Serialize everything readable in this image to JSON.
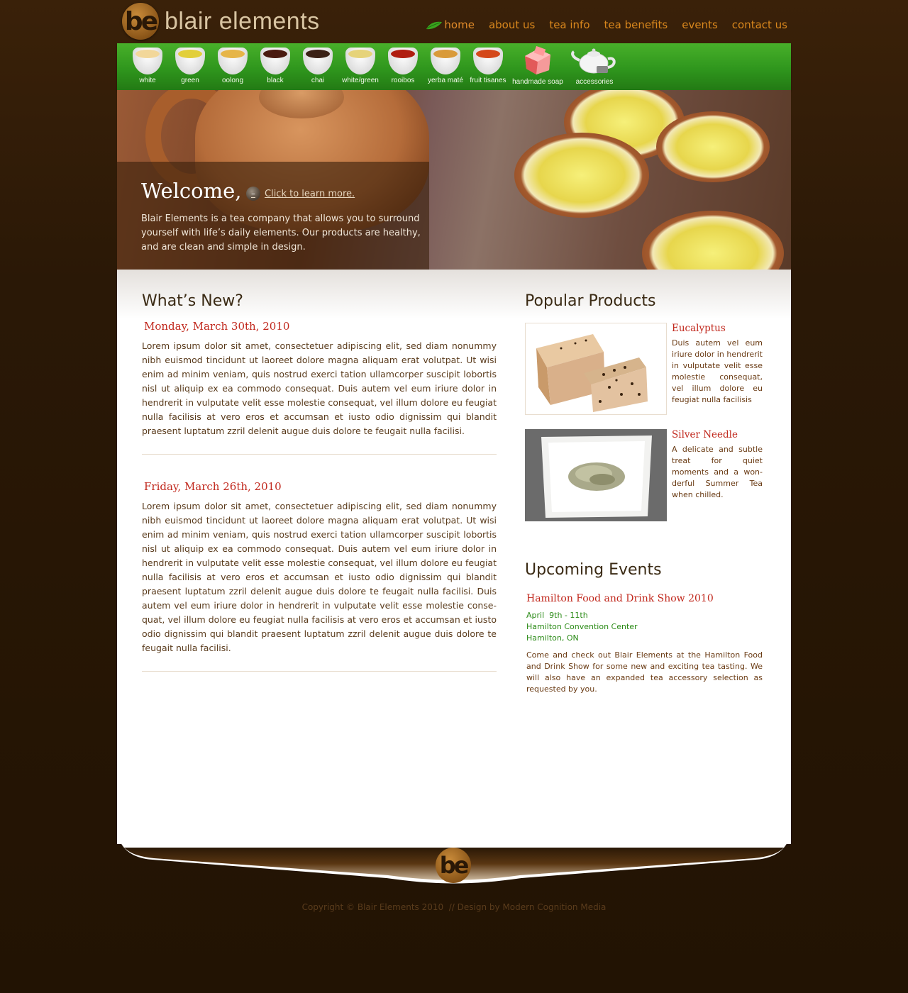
{
  "brand": {
    "logo_mark": "be",
    "name": "blair elements"
  },
  "nav": {
    "items": [
      {
        "label": "home",
        "active": true
      },
      {
        "label": "about us"
      },
      {
        "label": "tea info"
      },
      {
        "label": "tea benefits"
      },
      {
        "label": "events"
      },
      {
        "label": "contact us"
      }
    ]
  },
  "categories": [
    {
      "label": "white",
      "liquid": "#f2d79a",
      "icon": "tea-cup-icon"
    },
    {
      "label": "green",
      "liquid": "#e2cf3a",
      "icon": "tea-cup-icon"
    },
    {
      "label": "oolong",
      "liquid": "#e6b548",
      "icon": "tea-cup-icon"
    },
    {
      "label": "black",
      "liquid": "#4a1a10",
      "icon": "tea-cup-icon"
    },
    {
      "label": "chai",
      "liquid": "#3b2116",
      "icon": "tea-cup-icon"
    },
    {
      "label": "white/green",
      "liquid": "#e6d37a",
      "icon": "tea-cup-icon"
    },
    {
      "label": "rooibos",
      "liquid": "#b01d10",
      "icon": "tea-cup-icon"
    },
    {
      "label": "yerba maté",
      "liquid": "#d99a3a",
      "icon": "tea-cup-icon"
    },
    {
      "label": "fruit tisanes",
      "liquid": "#d4481a",
      "icon": "tea-cup-icon"
    },
    {
      "label": "handmade soap",
      "icon": "soap-icon"
    },
    {
      "label": "accessories",
      "icon": "teapot-icon"
    }
  ],
  "hero": {
    "title": "Welcome,",
    "cta": "Click to learn more.",
    "description": "Blair Elements is a tea company that allows you to surround yourself with life’s daily elements. Our products are healthy, and are clean and simple in design."
  },
  "whats_new": {
    "heading": "What’s New?",
    "posts": [
      {
        "date": "Monday, March 30th, 2010",
        "body": "Lorem ipsum dolor sit amet, consectetuer adipiscing elit, sed diam nonummy nibh euismod tincidunt ut laoreet dolore magna aliquam erat volutpat. Ut wisi enim ad minim veniam, quis nostrud exerci tation ullamcorper suscipit lobortis nisl ut aliquip ex ea commodo consequat. Duis autem vel eum iriure dolor in hendrerit in vulputate velit esse molestie consequat, vel illum dolore eu feugiat nulla facilisis at vero eros et accumsan et iusto odio dignissim qui blandit praesent luptatum zzril delenit augue duis dolore te feugait nulla facilisi."
      },
      {
        "date": "Friday, March 26th, 2010",
        "body": "Lorem ipsum dolor sit amet, consectetuer adipiscing elit, sed diam nonummy nibh euismod tincidunt ut laoreet dolore magna aliquam erat volutpat. Ut wisi enim ad minim veniam, quis nostrud exerci tation ullamcorper suscipit lobortis nisl ut aliquip ex ea commodo consequat. Duis autem vel eum iriure dolor in hendrerit in vulputate velit esse molestie consequat, vel illum dolore eu feugiat nulla facilisis at vero eros et accumsan et iusto odio dignissim qui blandit praesent luptatum zzril delenit augue duis dolore te feugait nulla facilisi. Duis autem vel eum iriure dolor in hendrerit in vulputate velit esse molestie conse-quat, vel illum dolore eu feugiat nulla facilisis at vero eros et accumsan et iusto odio dignissim qui blandit praesent luptatum zzril delenit augue duis dolore te feugait nulla facilisi."
      }
    ]
  },
  "popular_products": {
    "heading": "Popular Products",
    "items": [
      {
        "name": "Eucalyptus",
        "description": "Duis autem vel eum iriure dolor in hendrerit in vulputate velit esse molestie consequat, vel illum dolore eu feugiat nulla facilisis"
      },
      {
        "name": "Silver Needle",
        "description": "A delicate and subtle treat for quiet moments and a won-derful Summer Tea when chilled."
      }
    ]
  },
  "upcoming_events": {
    "heading": "Upcoming Events",
    "items": [
      {
        "title": "Hamilton Food and Drink Show 2010",
        "dates": "April  9th - 11th",
        "venue": "Hamilton Convention Center",
        "city": "Hamilton, ON",
        "description": "Come and check out Blair Elements at the Hamilton Food and Drink Show for some new and exciting tea tasting. We will also have an expanded tea accessory selection as requested by you."
      }
    ]
  },
  "footer": {
    "logo_mark": "be",
    "copyright": "Copyright © Blair Elements 2010  // Design by Modern Cognition Media"
  }
}
